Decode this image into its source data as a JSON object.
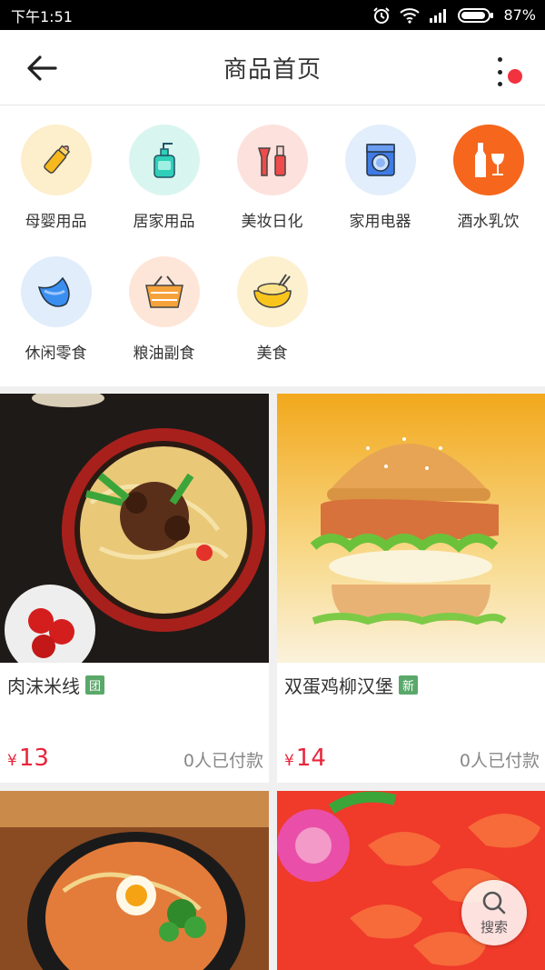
{
  "status": {
    "time": "下午1:51",
    "battery": "87%"
  },
  "header": {
    "title": "商品首页"
  },
  "categories": [
    {
      "label": "母婴用品",
      "icon": "baby-bottle-icon",
      "bg": "#fdeecc"
    },
    {
      "label": "居家用品",
      "icon": "soap-dispenser-icon",
      "bg": "#d8f6ef"
    },
    {
      "label": "美妆日化",
      "icon": "cosmetics-icon",
      "bg": "#fde1dc"
    },
    {
      "label": "家用电器",
      "icon": "washing-machine-icon",
      "bg": "#e3eefc"
    },
    {
      "label": "酒水乳饮",
      "icon": "wine-bottle-icon",
      "bg": "#f6661c"
    },
    {
      "label": "休闲零食",
      "icon": "snack-icon",
      "bg": "#e1edfb"
    },
    {
      "label": "粮油副食",
      "icon": "basket-icon",
      "bg": "#fde6d7"
    },
    {
      "label": "美食",
      "icon": "food-bowl-icon",
      "bg": "#fdf0cf"
    }
  ],
  "products": [
    {
      "name": "肉沫米线",
      "badge": "团",
      "price": "13",
      "currency": "¥",
      "sold": "0人已付款"
    },
    {
      "name": "双蛋鸡柳汉堡",
      "badge": "新",
      "price": "14",
      "currency": "¥",
      "sold": "0人已付款"
    }
  ],
  "fab": {
    "search_label": "搜索"
  },
  "colors": {
    "price": "#e8253a",
    "badge": "#5aa86a",
    "notif": "#f2323f"
  }
}
